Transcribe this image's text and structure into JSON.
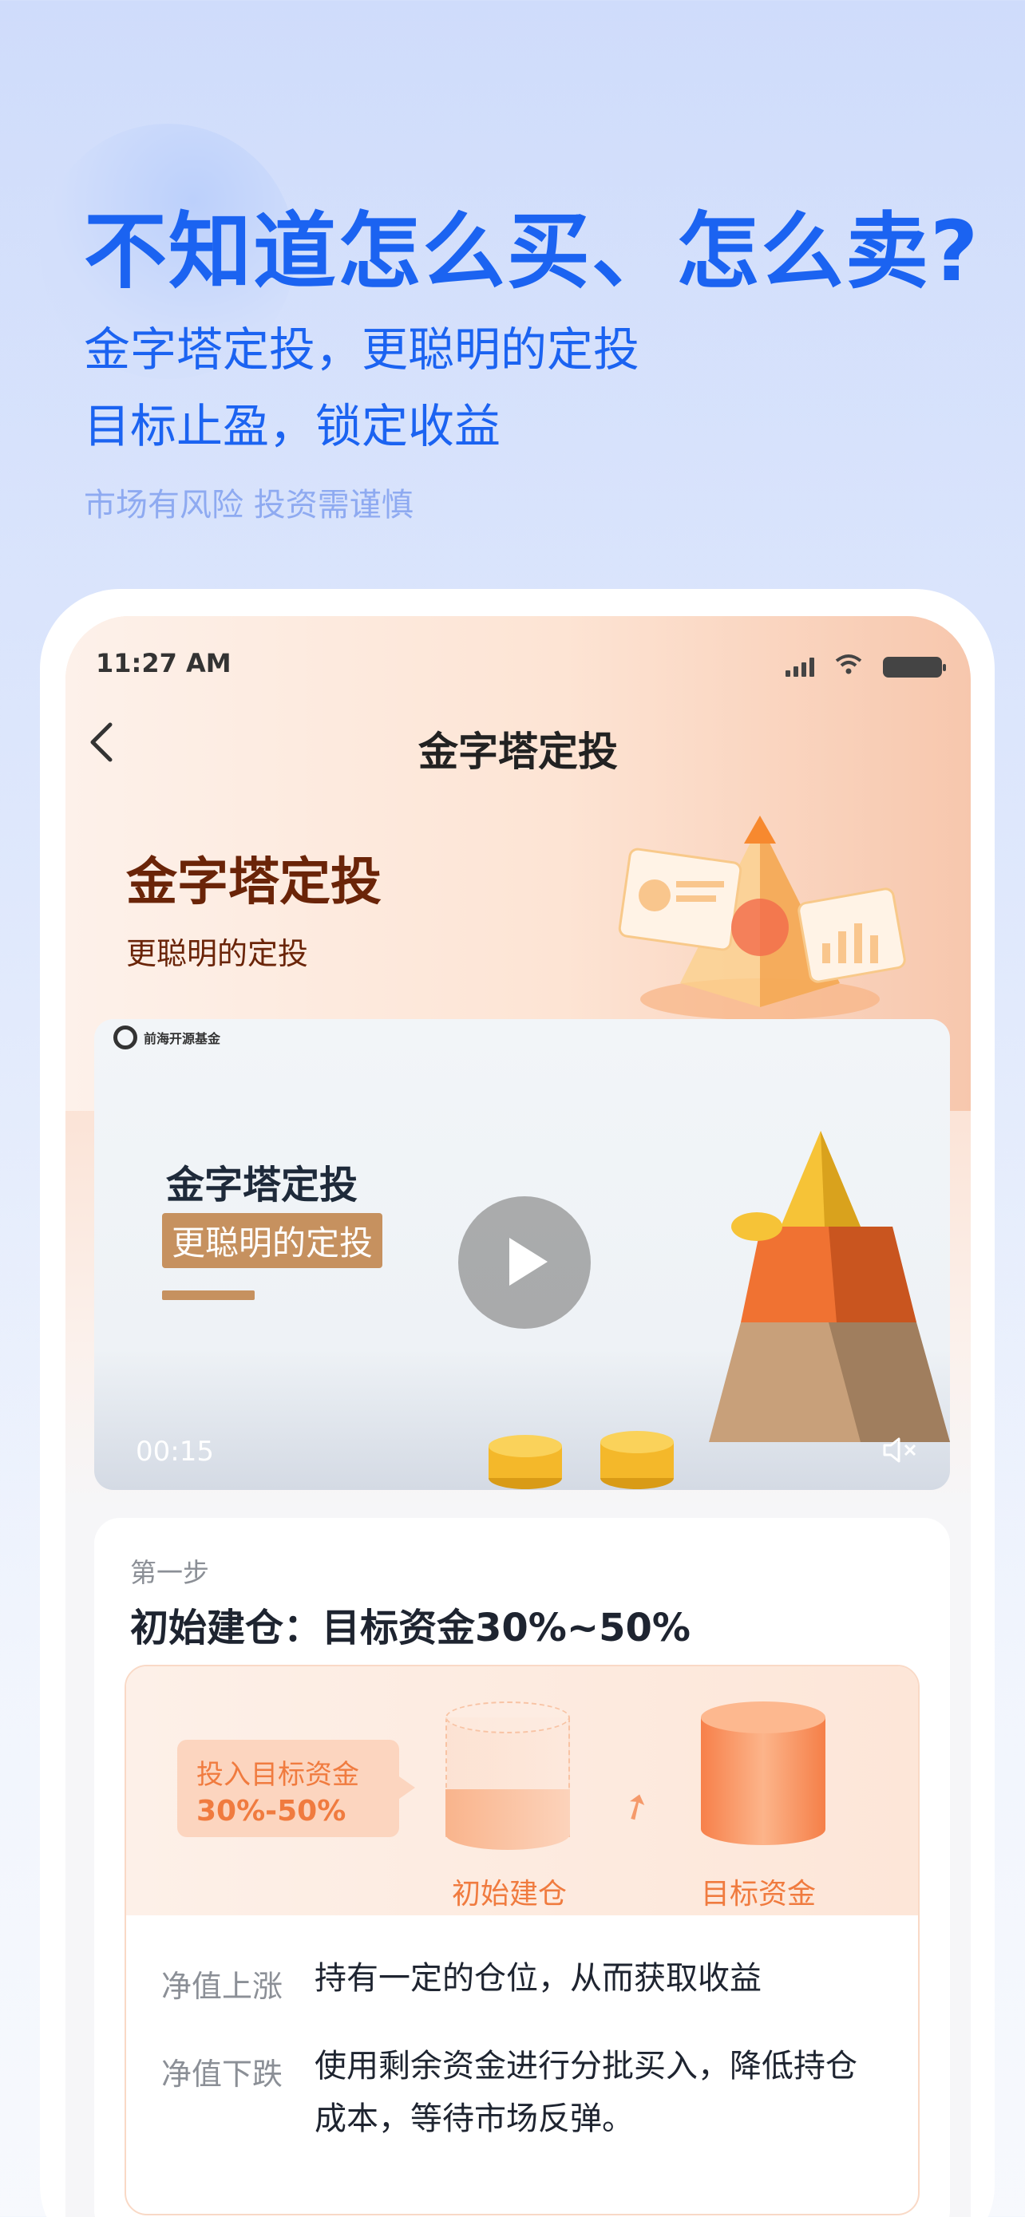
{
  "hero": {
    "title": "不知道怎么买、怎么卖?",
    "subtitle1": "金字塔定投，更聪明的定投",
    "subtitle2": "目标止盈，锁定收益",
    "risk_notice": "市场有风险 投资需谨慎"
  },
  "status_bar": {
    "time": "11:27 AM"
  },
  "nav": {
    "title": "金字塔定投",
    "back_icon": "chevron-left-icon"
  },
  "banner": {
    "title": "金字塔定投",
    "subtitle": "更聪明的定投"
  },
  "video": {
    "title": "金字塔定投",
    "tag": "更聪明的定投",
    "time": "00:15",
    "logo_text": "前海开源基金"
  },
  "step": {
    "label": "第一步",
    "title": "初始建仓：目标资金30%~50%",
    "bubble_line1": "投入目标资金",
    "bubble_line2": "30%-50%",
    "caption_left": "初始建仓",
    "caption_right": "目标资金",
    "rows": [
      {
        "label": "净值上涨",
        "text": "持有一定的仓位，从而获取收益"
      },
      {
        "label": "净值下跌",
        "text": "使用剩余资金进行分批买入，降低持仓成本，等待市场反弹。"
      }
    ]
  },
  "colors": {
    "brand_blue": "#1b63f1",
    "accent_orange": "#f07b3f",
    "banner_brown": "#6a2408"
  }
}
